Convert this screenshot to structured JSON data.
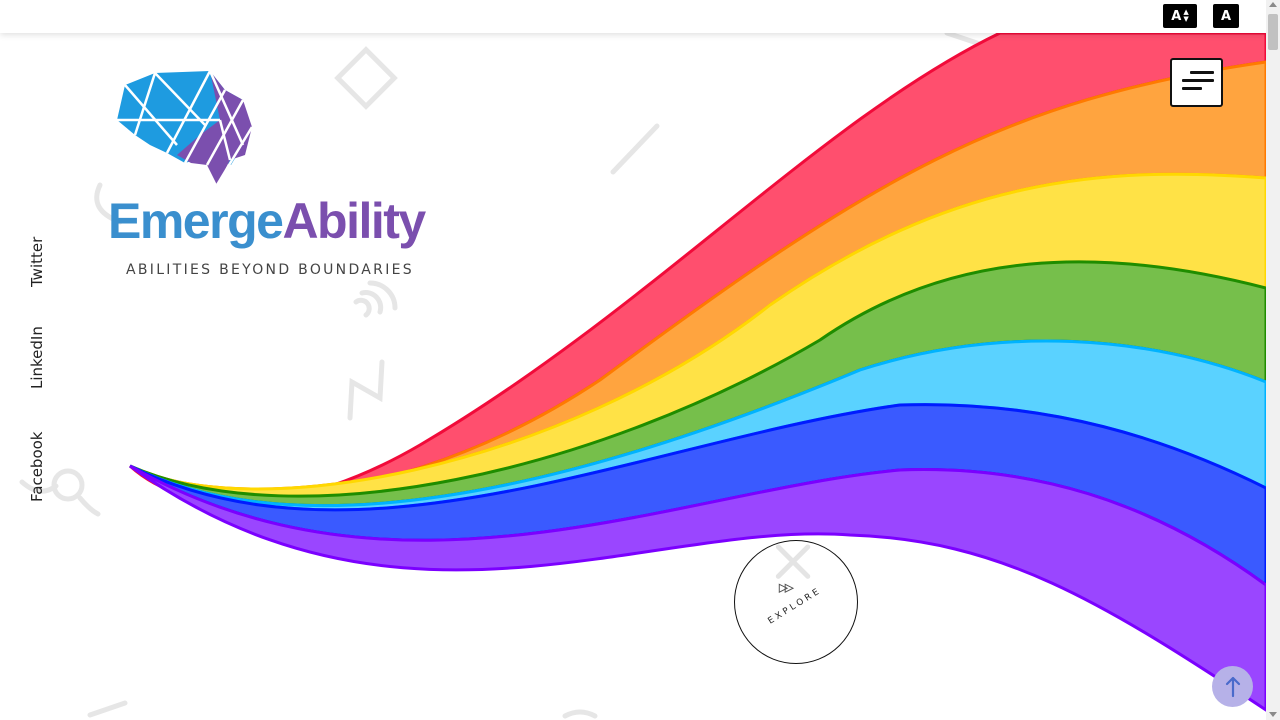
{
  "topbar": {
    "font_size_label": "A",
    "contrast_label": "A"
  },
  "brand": {
    "name_part1": "Emerge",
    "name_part2": "Ability",
    "tagline": "ABILITIES BEYOND BOUNDARIES",
    "colors": {
      "emerge": "#3a8fce",
      "ability": "#7b4fae"
    }
  },
  "social": {
    "items": [
      {
        "label": "Twitter"
      },
      {
        "label": "LinkedIn"
      },
      {
        "label": "Facebook"
      }
    ]
  },
  "hero": {
    "explore_label": "EXPLORE",
    "rainbow_colors": [
      "#ff4f6e",
      "#ffa43f",
      "#ffe246",
      "#76bf4b",
      "#5ad2ff",
      "#3a5aff",
      "#9a46ff"
    ]
  },
  "icons": {
    "menu": "hamburger-icon",
    "scroll_top": "arrow-up-icon",
    "explore": "play-icon"
  }
}
